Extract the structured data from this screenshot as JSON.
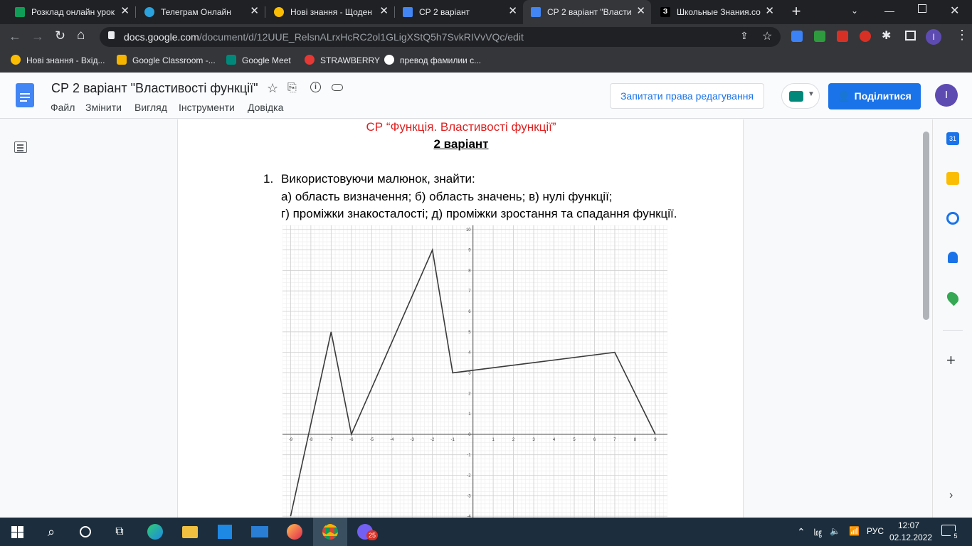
{
  "browser": {
    "tabs": [
      {
        "label": "Розклад онлайн урок",
        "icon": "sheets-icon",
        "color": "#0f9d58"
      },
      {
        "label": "Телеграм Онлайн",
        "icon": "telegram-icon",
        "color": "#2aa3df"
      },
      {
        "label": "Нові знання - Щоден",
        "icon": "bulb-icon",
        "color": "#fbbc04"
      },
      {
        "label": "СР 2 варіант",
        "icon": "classroom-doc-icon",
        "color": "#4285f4"
      },
      {
        "label": "СР 2 варіант \"Властив",
        "icon": "docs-icon",
        "color": "#4285f4"
      },
      {
        "label": "Школьные Знания.со",
        "icon": "znanija-icon",
        "color": "#000000"
      }
    ],
    "active_tab_index": 4,
    "url_host": "docs.google.com",
    "url_path": "/document/d/12UUE_RelsnALrxHcRC2ol1GLigXStQ5h7SvkRIVvVQc/edit",
    "bookmarks": [
      {
        "label": "Нові знання - Вхід...",
        "icon": "bulb-icon"
      },
      {
        "label": "Google Classroom -...",
        "icon": "classroom-icon"
      },
      {
        "label": "Google Meet",
        "icon": "meet-icon"
      },
      {
        "label": "STRAWBERRY",
        "icon": "strawberry-icon"
      },
      {
        "label": "превод фамилии с...",
        "icon": "google-icon"
      }
    ],
    "profile_initial": "I"
  },
  "docs": {
    "title": "СР 2 варіант \"Властивості функції\"",
    "menu": [
      "Файл",
      "Змінити",
      "Вигляд",
      "Інструменти",
      "Довідка"
    ],
    "request_edit_label": "Запитати права редагування",
    "share_label": "Поділитися",
    "user_initial": "I",
    "accent": "#1a73e8"
  },
  "document": {
    "heading": "СР “Функція. Властивості функції”",
    "variant": "2 варіант",
    "question_number": "1.",
    "question_lines": [
      "Використовуючи малюнок, знайти:",
      "а) область визначення;   б) область значень;   в) нулі функції;",
      "г) проміжки знакосталості; д) проміжки зростання та спадання функції."
    ]
  },
  "chart_data": {
    "type": "line",
    "x_ticks": [
      -9,
      -8,
      -7,
      -6,
      -5,
      -4,
      -3,
      -2,
      -1,
      0,
      1,
      2,
      3,
      4,
      5,
      6,
      7,
      8,
      9
    ],
    "y_ticks": [
      10,
      9,
      8,
      7,
      6,
      5,
      4,
      3,
      2,
      1,
      0,
      -1,
      -2,
      -3,
      -4
    ],
    "xlim": [
      -9.4,
      9.6
    ],
    "ylim": [
      -4.1,
      10.2
    ],
    "grid": true,
    "series": [
      {
        "x": [
          -9,
          -7,
          -6,
          -2,
          -1,
          7,
          9
        ],
        "y": [
          -4,
          5,
          0,
          9,
          3,
          4,
          0
        ]
      }
    ]
  },
  "taskbar": {
    "apps": [
      "windows-icon",
      "search-icon",
      "cortana-icon",
      "task-view-icon",
      "edge-icon",
      "explorer-icon",
      "store-icon",
      "mail-icon",
      "firefox-icon",
      "chrome-icon",
      "viber-icon"
    ],
    "viber_badge": "25",
    "lang": "РУС",
    "time": "12:07",
    "date": "02.12.2022",
    "notifications": "5"
  }
}
